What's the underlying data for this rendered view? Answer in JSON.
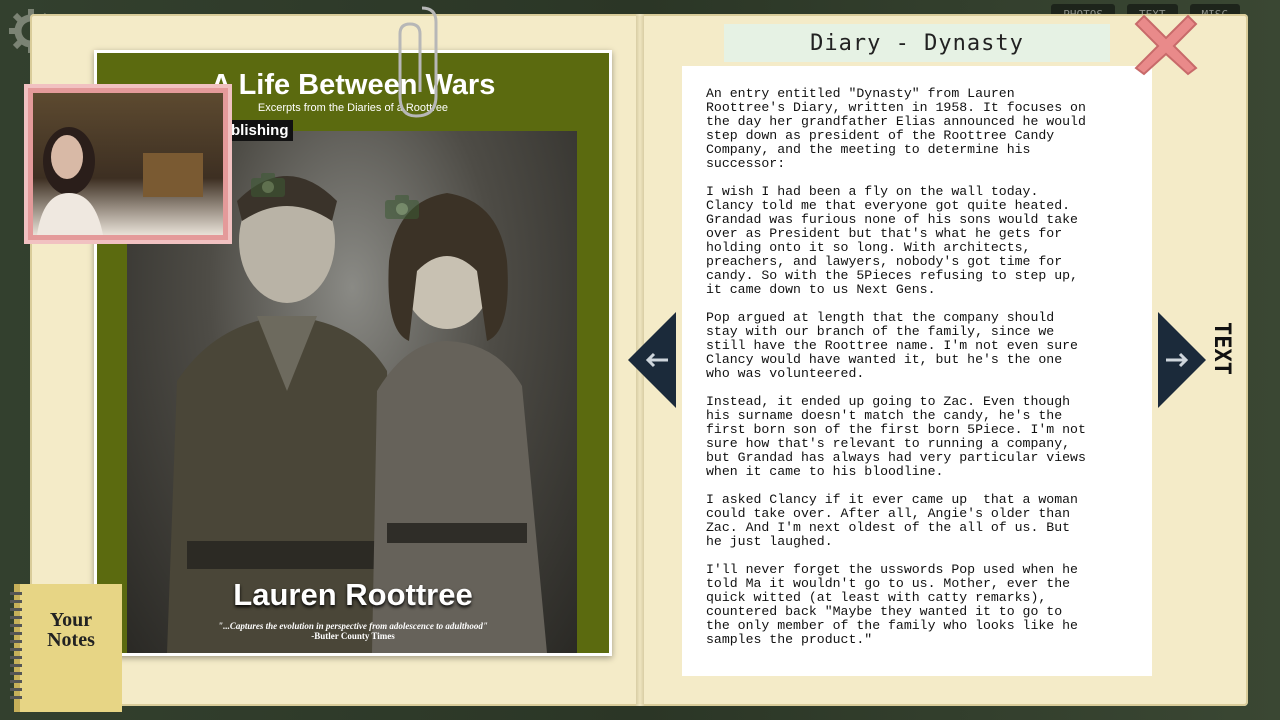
{
  "top_tabs": [
    "PHOTOS",
    "TEXT",
    "MISC"
  ],
  "cover": {
    "title": "A Life Between Wars",
    "subtitle": "Excerpts from the Diaries of a Roottree",
    "publishing_tag": "blishing",
    "author": "Lauren Roottree",
    "quote": "\"...Captures the evolution in perspective from adolescence to adulthood\"",
    "quote_source": "-Butler County Times"
  },
  "notes": {
    "label_line1": "Your",
    "label_line2": "Notes"
  },
  "diary": {
    "header": "Diary - Dynasty",
    "body": "An entry entitled \"Dynasty\" from Lauren\nRoottree's Diary, written in 1958. It focuses on\nthe day her grandfather Elias announced he would\nstep down as president of the Roottree Candy\nCompany, and the meeting to determine his\nsuccessor:\n\nI wish I had been a fly on the wall today.\nClancy told me that everyone got quite heated.\nGrandad was furious none of his sons would take\nover as President but that's what he gets for\nholding onto it so long. With architects,\npreachers, and lawyers, nobody's got time for\ncandy. So with the 5Pieces refusing to step up,\nit came down to us Next Gens.\n\nPop argued at length that the company should\nstay with our branch of the family, since we\nstill have the Roottree name. I'm not even sure\nClancy would have wanted it, but he's the one\nwho was volunteered.\n\nInstead, it ended up going to Zac. Even though\nhis surname doesn't match the candy, he's the\nfirst born son of the first born 5Piece. I'm not\nsure how that's relevant to running a company,\nbut Grandad has always had very particular views\nwhen it came to his bloodline.\n\nI asked Clancy if it ever came up  that a woman\ncould take over. After all, Angie's older than\nZac. And I'm next oldest of the all of us. But\nhe just laughed.\n\nI'll never forget the usswords Pop used when he\ntold Ma it wouldn't go to us. Mother, ever the\nquick witted (at least with catty remarks),\ncountered back \"Maybe they wanted it to go to\nthe only member of the family who looks like he\nsamples the product.\""
  },
  "side_tab": "TEXT",
  "colors": {
    "cover_green": "#5b6a0f",
    "book_cream": "#f4ebc8",
    "arrow_navy": "#1b2a3a",
    "close_red": "#e98a8a"
  }
}
